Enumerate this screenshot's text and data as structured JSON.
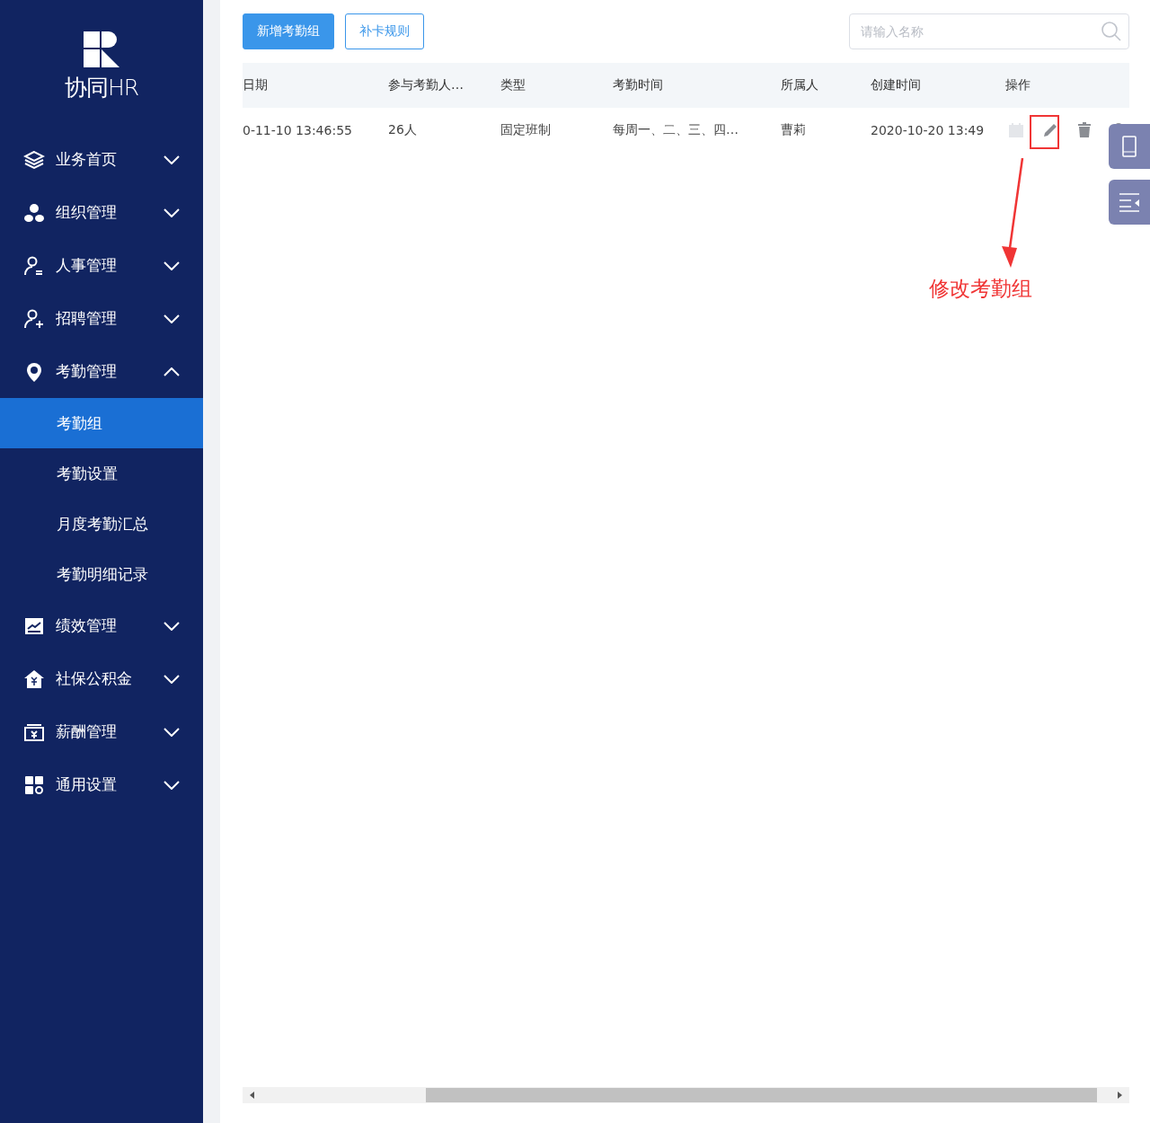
{
  "sidebar": {
    "logo_text": "协同HR",
    "items": [
      {
        "label": "业务首页",
        "expanded": false
      },
      {
        "label": "组织管理",
        "expanded": false
      },
      {
        "label": "人事管理",
        "expanded": false
      },
      {
        "label": "招聘管理",
        "expanded": false
      },
      {
        "label": "考勤管理",
        "expanded": true,
        "children": [
          {
            "label": "考勤组",
            "selected": true
          },
          {
            "label": "考勤设置",
            "selected": false
          },
          {
            "label": "月度考勤汇总",
            "selected": false
          },
          {
            "label": "考勤明细记录",
            "selected": false
          }
        ]
      },
      {
        "label": "绩效管理",
        "expanded": false
      },
      {
        "label": "社保公积金",
        "expanded": false
      },
      {
        "label": "薪酬管理",
        "expanded": false
      },
      {
        "label": "通用设置",
        "expanded": false
      }
    ]
  },
  "toolbar": {
    "buttons": [
      {
        "label": "新增考勤组",
        "kind": "primary"
      },
      {
        "label": "补卡规则",
        "kind": "outline"
      }
    ],
    "search": {
      "placeholder": "请输入名称"
    }
  },
  "table": {
    "columns": [
      "日期",
      "参与考勤人…",
      "类型",
      "考勤时间",
      "所属人",
      "创建时间",
      "操作"
    ],
    "rows": [
      [
        "0-11-10 13:46:55",
        "26人",
        "固定班制",
        "每周一、二、三、四…",
        "曹莉",
        "2020-10-20 13:49"
      ]
    ]
  },
  "annotation": {
    "text": "修改考勤组"
  }
}
